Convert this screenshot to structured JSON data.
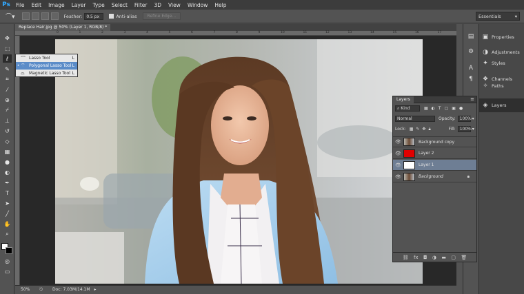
{
  "app": {
    "logo": "Ps"
  },
  "menu": [
    "File",
    "Edit",
    "Image",
    "Layer",
    "Type",
    "Select",
    "Filter",
    "3D",
    "View",
    "Window",
    "Help"
  ],
  "options_bar": {
    "feather_label": "Feather:",
    "feather_value": "0.5 px",
    "antialias_label": "Anti-alias",
    "refine_edge_label": "Refine Edge..."
  },
  "workspace": {
    "selected": "Essentials"
  },
  "document": {
    "tab_title": "Replace Hair.jpg @ 50% (Layer 1, RGB/8) *",
    "zoom": "50%",
    "doc_size": "Doc: 7.03M/14.1M"
  },
  "ruler_ticks": [
    "0",
    "1",
    "2",
    "3",
    "4",
    "5",
    "6",
    "7",
    "8",
    "9",
    "10",
    "11",
    "12",
    "13",
    "14",
    "15",
    "16",
    "17"
  ],
  "tool_flyout": {
    "items": [
      {
        "label": "Lasso Tool",
        "key": "L",
        "selected": false,
        "icon": "lasso-icon"
      },
      {
        "label": "Polygonal Lasso Tool",
        "key": "L",
        "selected": true,
        "icon": "polygonal-lasso-icon"
      },
      {
        "label": "Magnetic Lasso Tool",
        "key": "L",
        "selected": false,
        "icon": "magnetic-lasso-icon"
      }
    ]
  },
  "dock": {
    "items": [
      {
        "label": "Properties",
        "icon": "properties-icon"
      },
      {
        "label": "Adjustments",
        "icon": "adjustments-icon"
      },
      {
        "label": "Styles",
        "icon": "styles-icon"
      },
      {
        "label": "Channels",
        "icon": "channels-icon"
      },
      {
        "label": "Paths",
        "icon": "paths-icon"
      },
      {
        "label": "Layers",
        "icon": "layers-icon"
      }
    ]
  },
  "layers_panel": {
    "tab": "Layers",
    "filter_kind": "Kind",
    "blend_mode": "Normal",
    "opacity_label": "Opacity:",
    "opacity_value": "100%",
    "lock_label": "Lock:",
    "fill_label": "Fill:",
    "fill_value": "100%",
    "layers": [
      {
        "name": "Background copy",
        "thumb": "photo",
        "selected": false,
        "italic": false
      },
      {
        "name": "Layer 2",
        "thumb": "#e00000",
        "selected": false,
        "italic": false
      },
      {
        "name": "Layer 1",
        "thumb": "#ffffff",
        "selected": true,
        "italic": false
      },
      {
        "name": "Background",
        "thumb": "photo",
        "selected": false,
        "italic": true
      }
    ]
  }
}
